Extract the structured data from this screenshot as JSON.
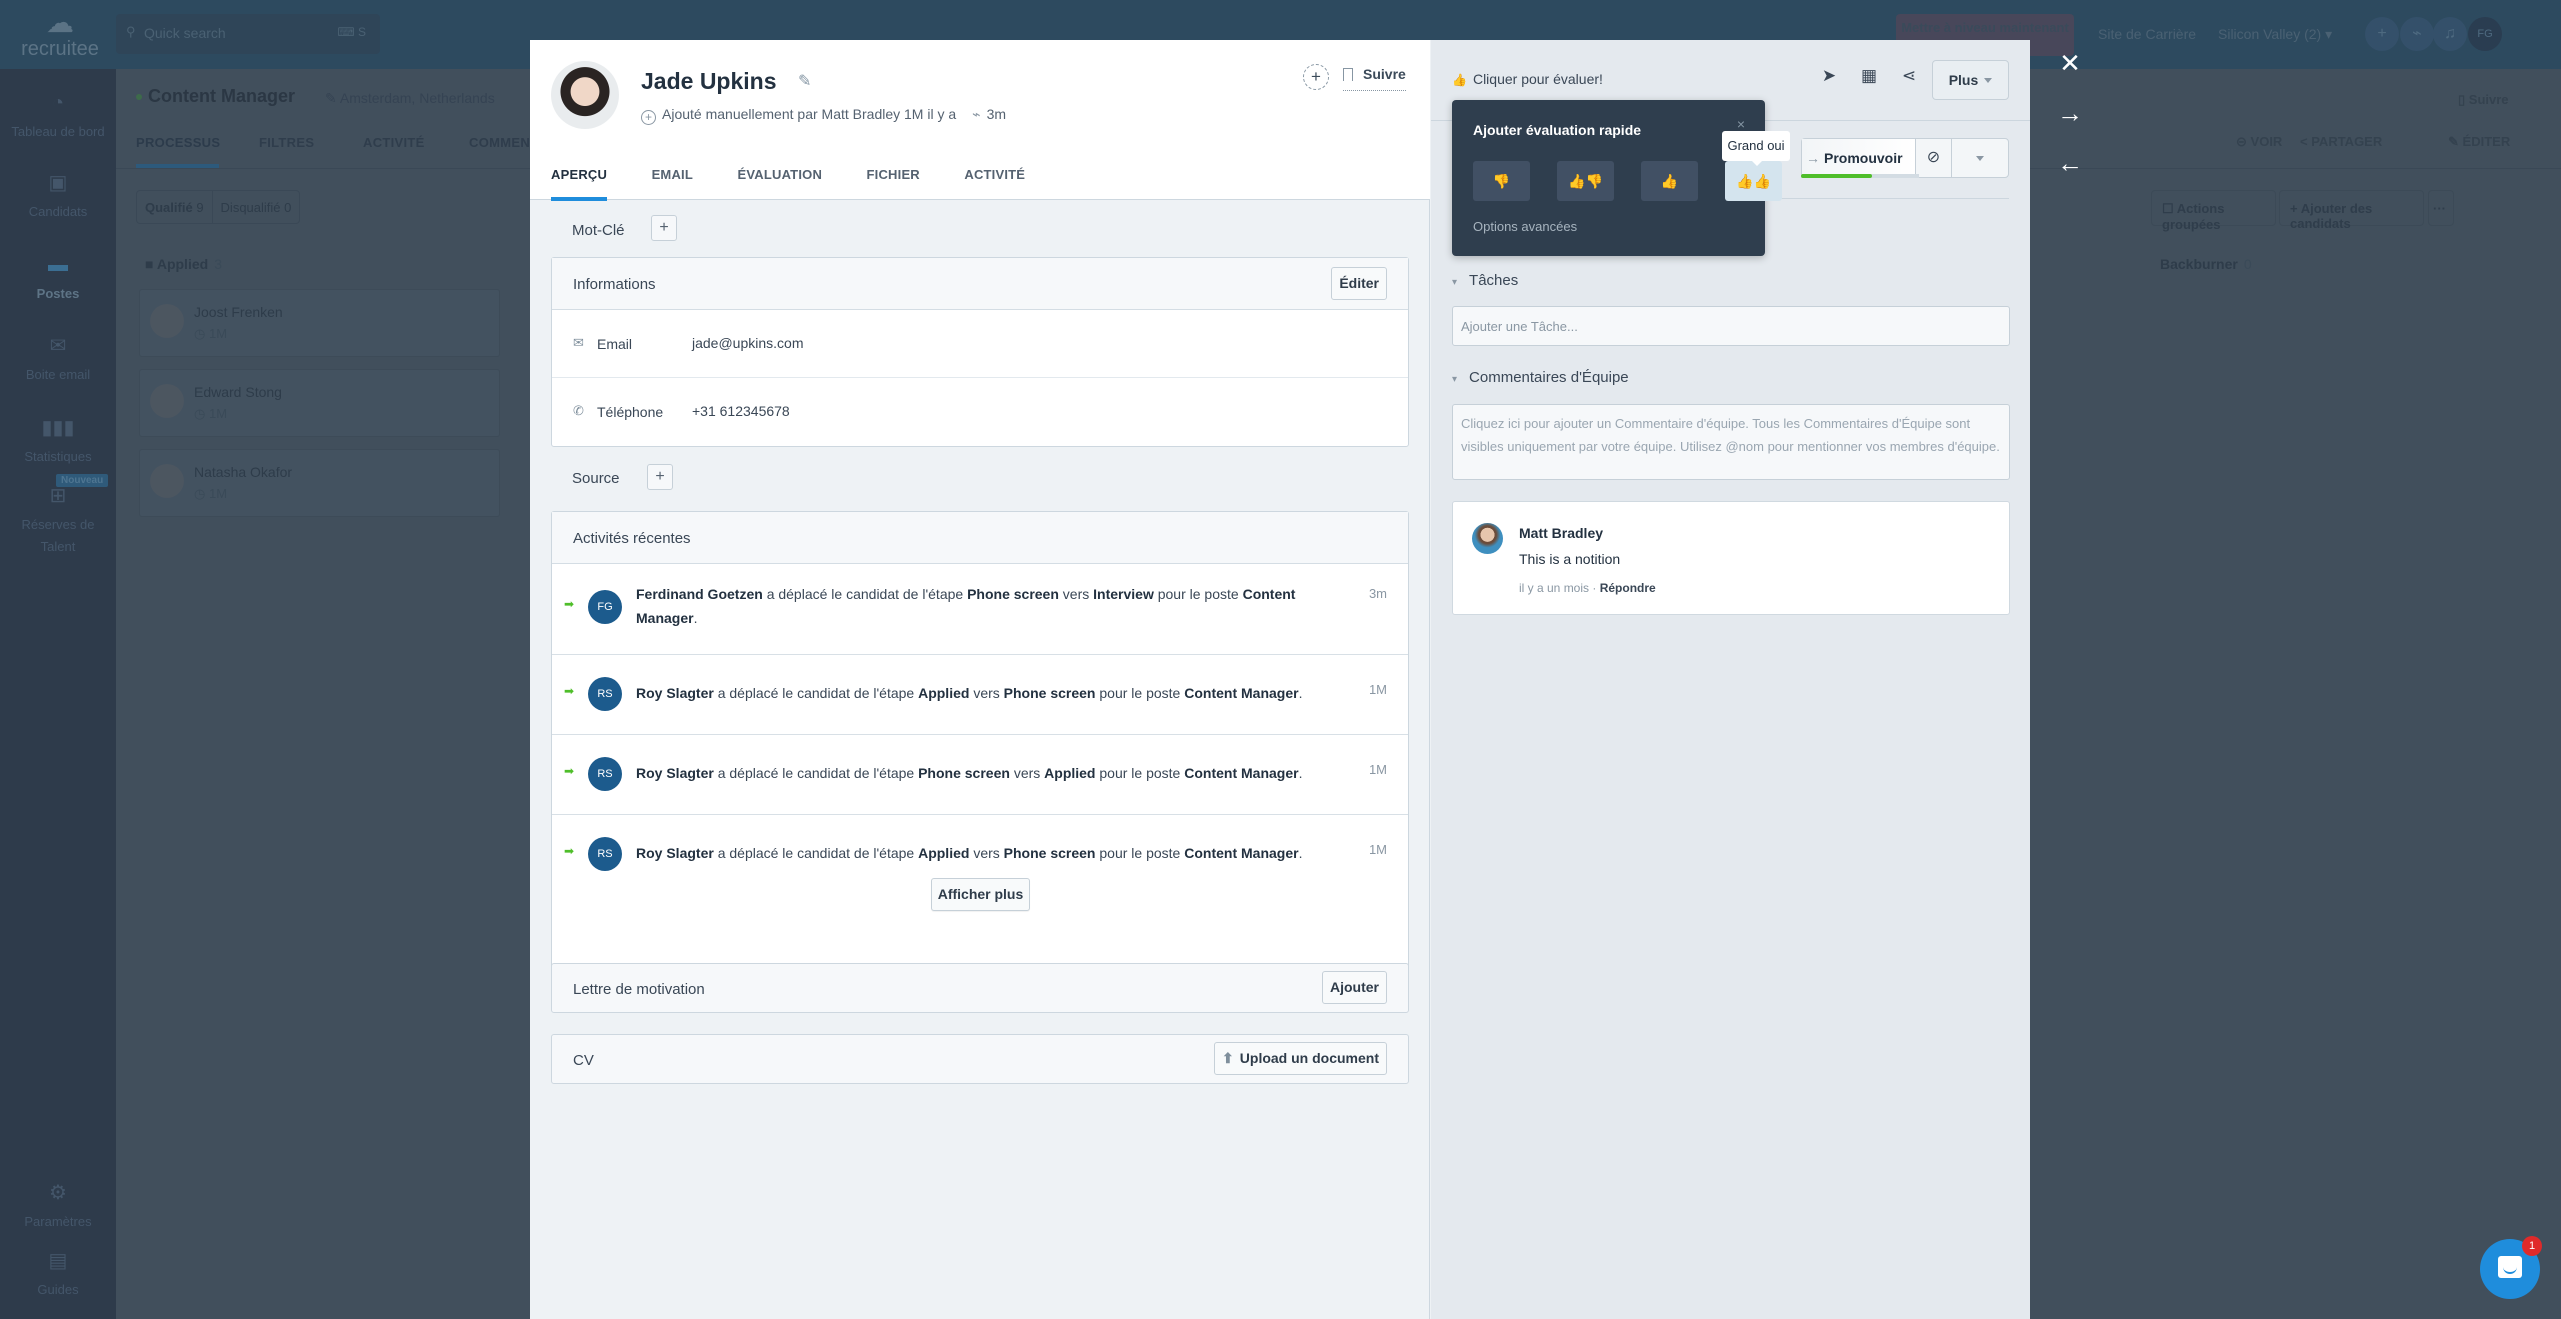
{
  "background_app": {
    "logo_text": "recruitee",
    "search": {
      "placeholder": "Quick search",
      "shortcut": "S"
    },
    "upgrade_button": "Mettre à niveau maintenant",
    "career_site_link": "Site de Carrière",
    "company_selector": "Silicon Valley (2)",
    "user_initials": "FG",
    "sidebar": [
      {
        "label": "Tableau de bord",
        "icon": "dashboard-icon"
      },
      {
        "label": "Candidats",
        "icon": "candidates-icon"
      },
      {
        "label": "Postes",
        "icon": "briefcase-icon",
        "active": true
      },
      {
        "label": "Boite email",
        "icon": "mail-icon"
      },
      {
        "label": "Statistiques",
        "icon": "bar-chart-icon",
        "badge": "Nouveau"
      },
      {
        "label": "Réserves de Talent",
        "icon": "org-chart-icon"
      },
      {
        "label": "Paramètres",
        "icon": "gear-icon"
      },
      {
        "label": "Guides",
        "icon": "book-icon"
      }
    ],
    "job": {
      "title": "Content Manager",
      "location": "Amsterdam, Netherlands",
      "tabs": [
        "PROCESSUS",
        "FILTRES",
        "ACTIVITÉ",
        "COMMENTAIRES"
      ],
      "active_tab": "PROCESSUS",
      "qualified_label": "Qualifié",
      "qualified_count": "9",
      "disqualified_label": "Disqualifié",
      "disqualified_count": "0",
      "actions": {
        "view": "VOIR",
        "share": "PARTAGER",
        "edit": "ÉDITER",
        "follow": "Suivre",
        "bulk": "Actions groupées",
        "add": "Ajouter des candidats",
        "more": "···"
      }
    },
    "columns": [
      {
        "title": "Applied",
        "count": "3"
      },
      {
        "title": "Backburner",
        "count": "0"
      }
    ],
    "candidates": [
      {
        "name": "Joost Frenken",
        "time": "1M"
      },
      {
        "name": "Edward Stong",
        "time": "1M"
      },
      {
        "name": "Natasha Okafor",
        "time": "1M"
      }
    ]
  },
  "candidate": {
    "name": "Jade Upkins",
    "added_by": "Ajouté manuellement par Matt Bradley 1M il y a",
    "last_activity": "3m",
    "follow_label": "Suivre",
    "tabs": [
      "APERÇU",
      "EMAIL",
      "ÉVALUATION",
      "FICHIER",
      "ACTIVITÉ"
    ],
    "active_tab": "APERÇU",
    "keyword_label": "Mot-Clé",
    "source_label": "Source",
    "info": {
      "title": "Informations",
      "edit_label": "Éditer",
      "email_label": "Email",
      "email": "jade@upkins.com",
      "phone_label": "Téléphone",
      "phone": "+31 612345678"
    },
    "recent": {
      "title": "Activités récentes",
      "items": [
        {
          "initials": "FG",
          "actor": "Ferdinand Goetzen",
          "verb": "a déplacé le candidat de l'étape",
          "from": "Phone screen",
          "to_word": "vers",
          "to": "Interview",
          "post_word": "pour le poste",
          "job": "Content Manager",
          "time": "3m"
        },
        {
          "initials": "RS",
          "actor": "Roy Slagter",
          "verb": "a déplacé le candidat de l'étape",
          "from": "Applied",
          "to_word": "vers",
          "to": "Phone screen",
          "post_word": "pour le poste",
          "job": "Content Manager",
          "time": "1M"
        },
        {
          "initials": "RS",
          "actor": "Roy Slagter",
          "verb": "a déplacé le candidat de l'étape",
          "from": "Phone screen",
          "to_word": "vers",
          "to": "Applied",
          "post_word": "pour le poste",
          "job": "Content Manager",
          "time": "1M"
        },
        {
          "initials": "RS",
          "actor": "Roy Slagter",
          "verb": "a déplacé le candidat de l'étape",
          "from": "Applied",
          "to_word": "vers",
          "to": "Phone screen",
          "post_word": "pour le poste",
          "job": "Content Manager",
          "time": "1M"
        }
      ],
      "show_more": "Afficher plus"
    },
    "cover_letter": {
      "title": "Lettre de motivation",
      "button": "Ajouter"
    },
    "cv": {
      "title": "CV",
      "button": "Upload un document"
    }
  },
  "right_panel": {
    "rate_hint": "Cliquer pour évaluer!",
    "more_label": "Plus",
    "promote_label": "Promouvoir",
    "stage_progress_percent": 60,
    "tasks": {
      "title": "Tâches",
      "placeholder": "Ajouter une Tâche..."
    },
    "comments": {
      "title": "Commentaires d'Équipe",
      "placeholder": "Cliquez ici pour ajouter un Commentaire d'équipe. Tous les Commentaires d'Équipe sont visibles uniquement par votre équipe. Utilisez @nom pour mentionner vos membres d'équipe.",
      "items": [
        {
          "author": "Matt Bradley",
          "text": "This is a notition",
          "time": "il y a un mois",
          "separator": "·",
          "reply": "Répondre"
        }
      ]
    }
  },
  "quick_rating": {
    "title": "Ajouter évaluation rapide",
    "close": "×",
    "options": [
      {
        "name": "Non",
        "icon": "thumbs-down-icon",
        "color": "#e8323f"
      },
      {
        "name": "Peut-être",
        "icon": "thumbs-mixed-icon",
        "color": "#efb02c"
      },
      {
        "name": "Oui",
        "icon": "thumbs-up-icon",
        "color": "#4fbe2a"
      },
      {
        "name": "Grand oui",
        "icon": "double-thumbs-up-icon",
        "color": "#4fbe2a",
        "hovered": true
      }
    ],
    "tooltip": "Grand oui",
    "advanced": "Options avancées"
  },
  "chat_widget": {
    "unread": "1"
  }
}
